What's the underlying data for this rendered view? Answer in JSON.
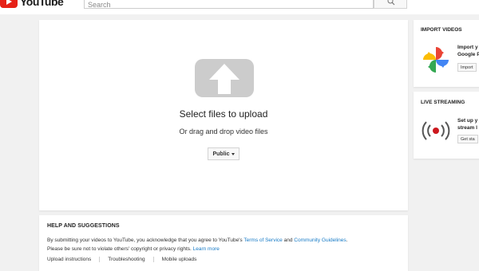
{
  "header": {
    "logo_text": "YouTube",
    "search_placeholder": "Search"
  },
  "upload": {
    "title": "Select files to upload",
    "subtitle": "Or drag and drop video files",
    "privacy_value": "Public"
  },
  "help": {
    "heading": "HELP AND SUGGESTIONS",
    "line1_prefix": "By submitting your videos to YouTube, you acknowledge that you agree to YouTube's ",
    "terms_link": "Terms of Service",
    "and_text": " and ",
    "guidelines_link": "Community Guidelines",
    "line1_suffix": ".",
    "line2_prefix": "Please be sure not to violate others' copyright or privacy rights. ",
    "learn_more": "Learn more",
    "links": [
      "Upload instructions",
      "Troubleshooting",
      "Mobile uploads"
    ]
  },
  "sidebar": {
    "import": {
      "heading": "IMPORT VIDEOS",
      "text_line1": "Import y",
      "text_line2": "Google P",
      "button": "Import"
    },
    "live": {
      "heading": "LIVE STREAMING",
      "text_line1": "Set up y",
      "text_line2": "stream l",
      "button": "Get sta"
    }
  },
  "colors": {
    "brand": "#e62117",
    "link": "#167ac6",
    "background": "#f1f1f1"
  }
}
